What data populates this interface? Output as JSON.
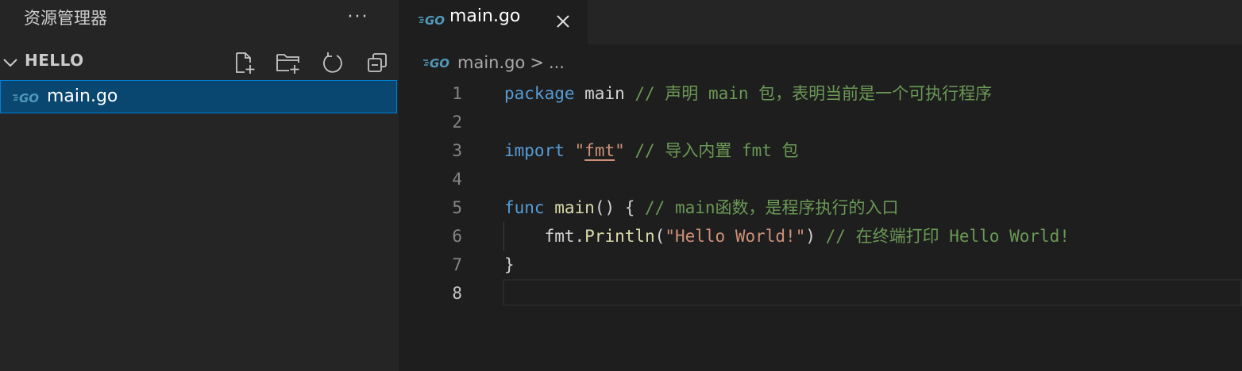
{
  "sidebar": {
    "title": "资源管理器",
    "more_label": "···",
    "section": {
      "title": "HELLO",
      "actions": [
        {
          "name": "new-file-icon"
        },
        {
          "name": "new-folder-icon"
        },
        {
          "name": "refresh-icon"
        },
        {
          "name": "collapse-all-icon"
        }
      ]
    },
    "files": [
      {
        "name": "main.go",
        "icon": "go-file-icon"
      }
    ]
  },
  "editor": {
    "tab": {
      "label": "main.go",
      "icon": "go-file-icon"
    },
    "breadcrumb": {
      "file": "main.go",
      "separator": ">",
      "more": "..."
    },
    "lines": [
      {
        "number": "1"
      },
      {
        "number": "2"
      },
      {
        "number": "3"
      },
      {
        "number": "4"
      },
      {
        "number": "5"
      },
      {
        "number": "6"
      },
      {
        "number": "7"
      },
      {
        "number": "8"
      }
    ],
    "code": {
      "l1": {
        "keyword": "package",
        "name": " main ",
        "comment": "// 声明 main 包，表明当前是一个可执行程序"
      },
      "l3": {
        "keyword": "import",
        "space": " ",
        "q1": "\"",
        "pkg": "fmt",
        "q2": "\"",
        "comment": " // 导入内置 fmt 包"
      },
      "l5": {
        "keyword": "func",
        "space": " ",
        "func": "main",
        "rest": "() { ",
        "comment": "// main函数，是程序执行的入口"
      },
      "l6": {
        "indent": "    ",
        "obj": "fmt.",
        "method": "Println",
        "open": "(",
        "str": "\"Hello World!\"",
        "close": ") ",
        "comment": "// 在终端打印 Hello World!"
      },
      "l7": {
        "brace": "}"
      }
    }
  },
  "colors": {
    "keyword": "#569cd6",
    "comment": "#6a9955",
    "function": "#dcdcaa",
    "string": "#ce9178",
    "selection": "#094771",
    "go_icon": "#519aba"
  }
}
